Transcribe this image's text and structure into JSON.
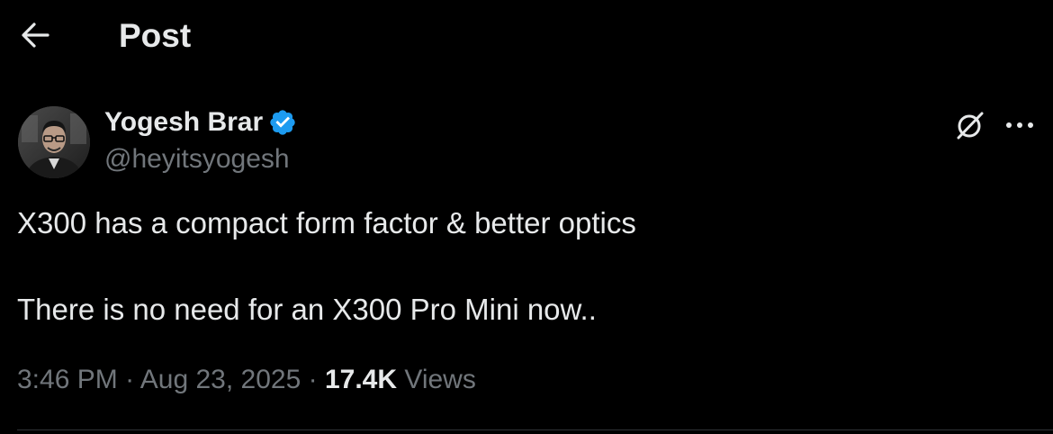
{
  "header": {
    "back_icon": "arrow-left-icon",
    "title": "Post"
  },
  "author": {
    "name": "Yogesh Brar",
    "handle": "@heyitsyogesh",
    "verified_icon": "verified-badge-icon",
    "verified_color": "#1d9bf0",
    "avatar": "avatar"
  },
  "actions": {
    "grok_icon": "grok-icon",
    "more_icon": "more-horizontal-icon"
  },
  "tweet": {
    "lines": [
      "X300 has a compact form factor & better optics",
      "There is no need for an X300 Pro Mini now.."
    ]
  },
  "meta": {
    "time": "3:46 PM",
    "separator": "·",
    "date": "Aug 23, 2025",
    "views_count": "17.4K",
    "views_label": "Views"
  },
  "colors": {
    "background": "#000000",
    "primary_text": "#e7e9ea",
    "secondary_text": "#71767b",
    "divider": "#2f3336"
  }
}
